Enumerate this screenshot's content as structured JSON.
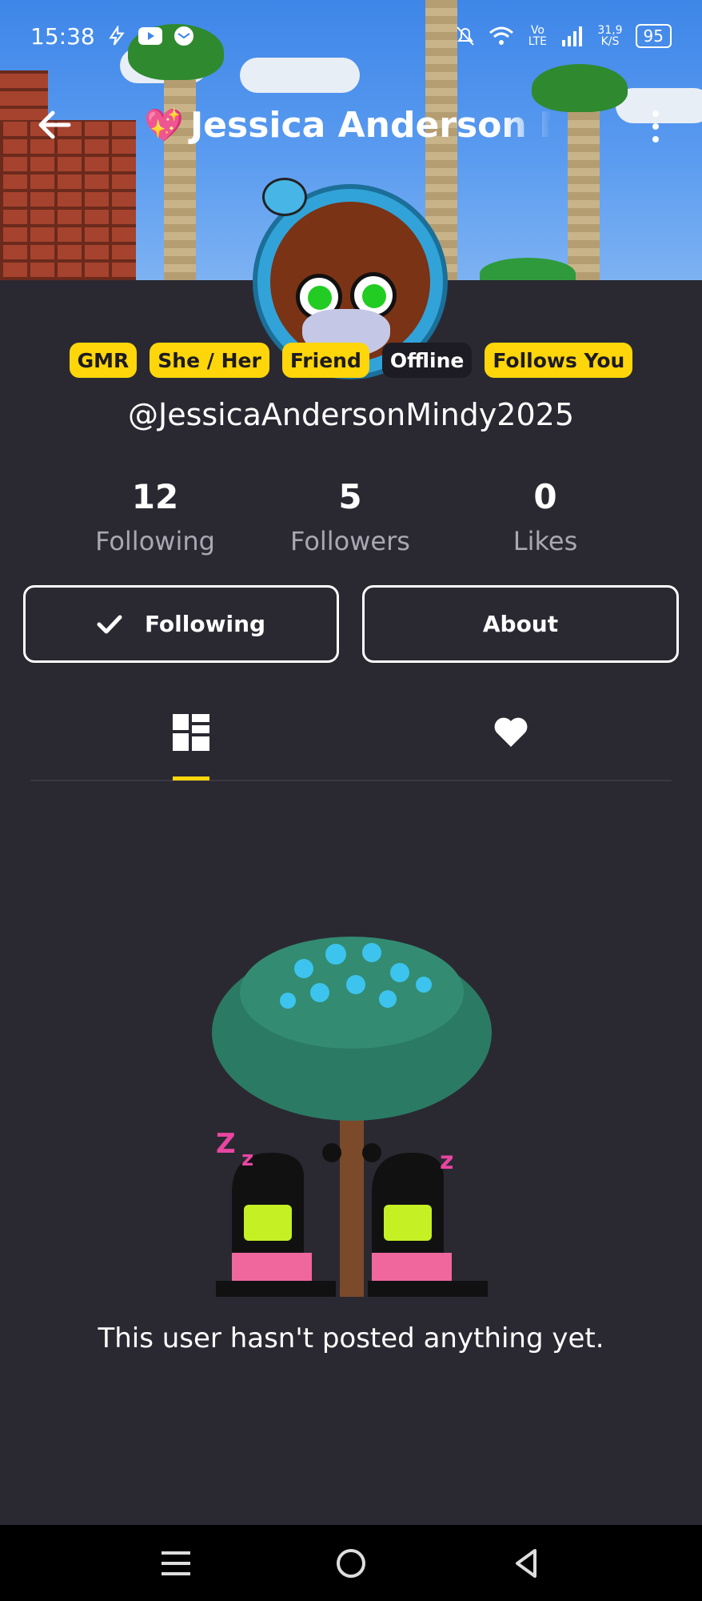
{
  "status_bar": {
    "time": "15:38",
    "network_speed": "31,9\nK/S",
    "network_label": "Vo LTE",
    "battery": "95",
    "icons": [
      "flash-icon",
      "youtube-icon",
      "message-icon",
      "mute-bell-icon",
      "wifi-icon",
      "signal-icon",
      "battery-icon"
    ]
  },
  "header": {
    "title": "Jessica Anderson Mi",
    "title_emoji": "💖",
    "back_icon": "arrow-left-icon",
    "menu_icon": "more-vertical-icon"
  },
  "profile": {
    "badges": [
      {
        "label": "GMR",
        "style": "yellow"
      },
      {
        "label": "She / Her",
        "style": "yellow"
      },
      {
        "label": "Friend",
        "style": "yellow"
      },
      {
        "label": "Offline",
        "style": "dark"
      },
      {
        "label": "Follows You",
        "style": "yellow"
      }
    ],
    "handle": "@JessicaAndersonMindy2025"
  },
  "stats": [
    {
      "value": "12",
      "label": "Following"
    },
    {
      "value": "5",
      "label": "Followers"
    },
    {
      "value": "0",
      "label": "Likes"
    }
  ],
  "actions": {
    "following_label": "Following",
    "about_label": "About"
  },
  "tabs": [
    {
      "icon": "grid-icon",
      "active": true
    },
    {
      "icon": "heart-icon",
      "active": false
    }
  ],
  "empty_state": {
    "message": "This user hasn't posted anything yet.",
    "illustration": "sleeping-characters-under-tree"
  },
  "colors": {
    "background": "#2a2932",
    "accent": "#ffd60a",
    "muted_text": "#a9a8b2",
    "nav_background": "#000000"
  },
  "nav_bar": {
    "icons": [
      "menu-icon",
      "home-circle-icon",
      "back-triangle-icon"
    ]
  }
}
